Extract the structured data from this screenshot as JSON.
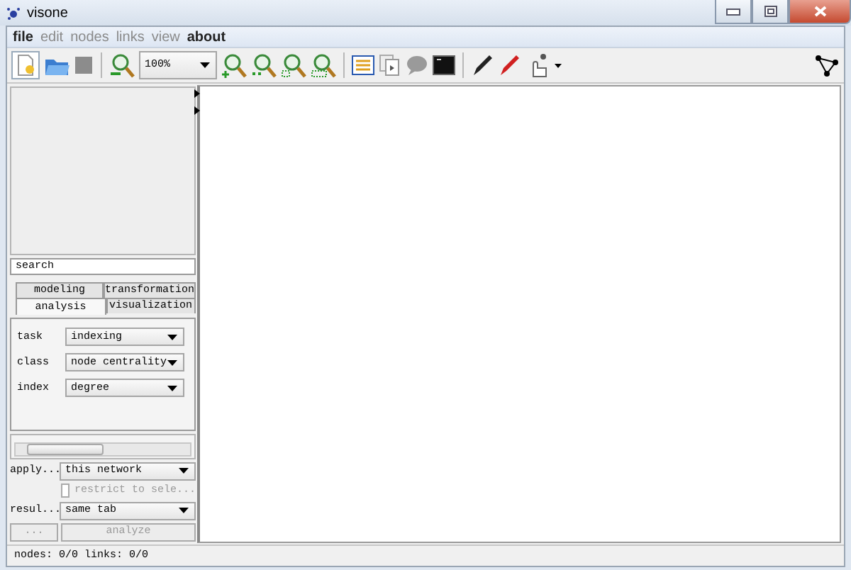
{
  "window": {
    "title": "visone"
  },
  "menu": [
    {
      "label": "file",
      "disabled": false
    },
    {
      "label": "edit",
      "disabled": true
    },
    {
      "label": "nodes",
      "disabled": true
    },
    {
      "label": "links",
      "disabled": true
    },
    {
      "label": "view",
      "disabled": true
    },
    {
      "label": "about",
      "disabled": false
    }
  ],
  "toolbar": {
    "zoom": "100%"
  },
  "panel": {
    "search": {
      "value": "search"
    },
    "tabs": [
      {
        "label": "modeling",
        "selected": false
      },
      {
        "label": "transformation",
        "selected": false
      },
      {
        "label": "analysis",
        "selected": true
      },
      {
        "label": "visualization",
        "selected": false
      }
    ],
    "fields": [
      {
        "label": "task",
        "value": "indexing"
      },
      {
        "label": "class",
        "value": "node centrality"
      },
      {
        "label": "index",
        "value": "degree"
      }
    ],
    "apply": {
      "label": "apply...",
      "value": "this network"
    },
    "restrict": {
      "label": "restrict to sele...",
      "checked": false,
      "disabled": true
    },
    "result": {
      "label": "resul...",
      "value": "same tab"
    },
    "buttons": [
      {
        "label": "...",
        "disabled": true
      },
      {
        "label": "analyze",
        "disabled": true
      }
    ]
  },
  "status_bar": {
    "text": "nodes: 0/0 links: 0/0"
  }
}
